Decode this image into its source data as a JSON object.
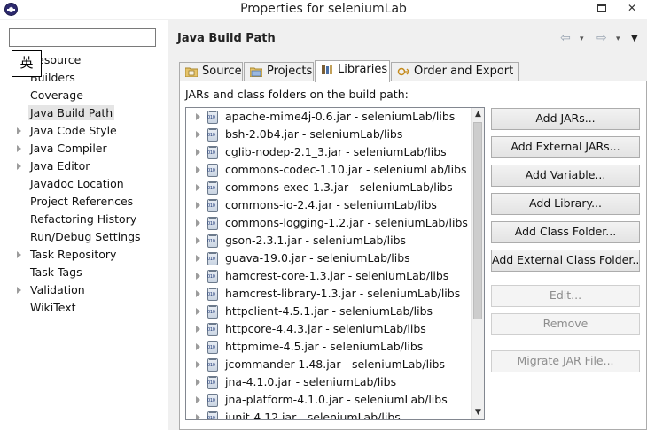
{
  "window": {
    "title": "Properties for seleniumLab",
    "app_icon": "eclipse-icon",
    "controls": {
      "maximize_icon": "maximize-icon",
      "close_glyph": "✕"
    }
  },
  "sidebar": {
    "filter_value": "",
    "ime_indicator": "英",
    "items": [
      {
        "label": "Resource",
        "expandable": false
      },
      {
        "label": "Builders",
        "expandable": false
      },
      {
        "label": "Coverage",
        "expandable": false
      },
      {
        "label": "Java Build Path",
        "expandable": false,
        "selected": true
      },
      {
        "label": "Java Code Style",
        "expandable": true
      },
      {
        "label": "Java Compiler",
        "expandable": true
      },
      {
        "label": "Java Editor",
        "expandable": true
      },
      {
        "label": "Javadoc Location",
        "expandable": false
      },
      {
        "label": "Project References",
        "expandable": false
      },
      {
        "label": "Refactoring History",
        "expandable": false
      },
      {
        "label": "Run/Debug Settings",
        "expandable": false
      },
      {
        "label": "Task Repository",
        "expandable": true
      },
      {
        "label": "Task Tags",
        "expandable": false
      },
      {
        "label": "Validation",
        "expandable": true
      },
      {
        "label": "WikiText",
        "expandable": false
      }
    ]
  },
  "page": {
    "title": "Java Build Path",
    "nav": {
      "back": "⇦",
      "forward": "⇨",
      "dropdown": "▾",
      "menu": "▼"
    },
    "tabs": [
      {
        "label": "Source",
        "icon": "source-folder-icon"
      },
      {
        "label": "Projects",
        "icon": "projects-folder-icon"
      },
      {
        "label": "Libraries",
        "icon": "libraries-icon",
        "active": true
      },
      {
        "label": "Order and Export",
        "icon": "order-export-icon"
      }
    ],
    "section_label": "JARs and class folders on the build path:",
    "jars": [
      "apache-mime4j-0.6.jar - seleniumLab/libs",
      "bsh-2.0b4.jar - seleniumLab/libs",
      "cglib-nodep-2.1_3.jar - seleniumLab/libs",
      "commons-codec-1.10.jar - seleniumLab/libs",
      "commons-exec-1.3.jar - seleniumLab/libs",
      "commons-io-2.4.jar - seleniumLab/libs",
      "commons-logging-1.2.jar - seleniumLab/libs",
      "gson-2.3.1.jar - seleniumLab/libs",
      "guava-19.0.jar - seleniumLab/libs",
      "hamcrest-core-1.3.jar - seleniumLab/libs",
      "hamcrest-library-1.3.jar - seleniumLab/libs",
      "httpclient-4.5.1.jar - seleniumLab/libs",
      "httpcore-4.4.3.jar - seleniumLab/libs",
      "httpmime-4.5.jar - seleniumLab/libs",
      "jcommander-1.48.jar - seleniumLab/libs",
      "jna-4.1.0.jar - seleniumLab/libs",
      "jna-platform-4.1.0.jar - seleniumLab/libs",
      "junit-4.12.jar - seleniumLab/libs"
    ],
    "buttons": [
      {
        "label": "Add JARs...",
        "enabled": true
      },
      {
        "label": "Add External JARs...",
        "enabled": true
      },
      {
        "label": "Add Variable...",
        "enabled": true
      },
      {
        "label": "Add Library...",
        "enabled": true
      },
      {
        "label": "Add Class Folder...",
        "enabled": true
      },
      {
        "label": "Add External Class Folder...",
        "enabled": true
      },
      {
        "label": "Edit...",
        "enabled": false
      },
      {
        "label": "Remove",
        "enabled": false
      },
      {
        "label": "Migrate JAR File...",
        "enabled": false
      }
    ]
  }
}
